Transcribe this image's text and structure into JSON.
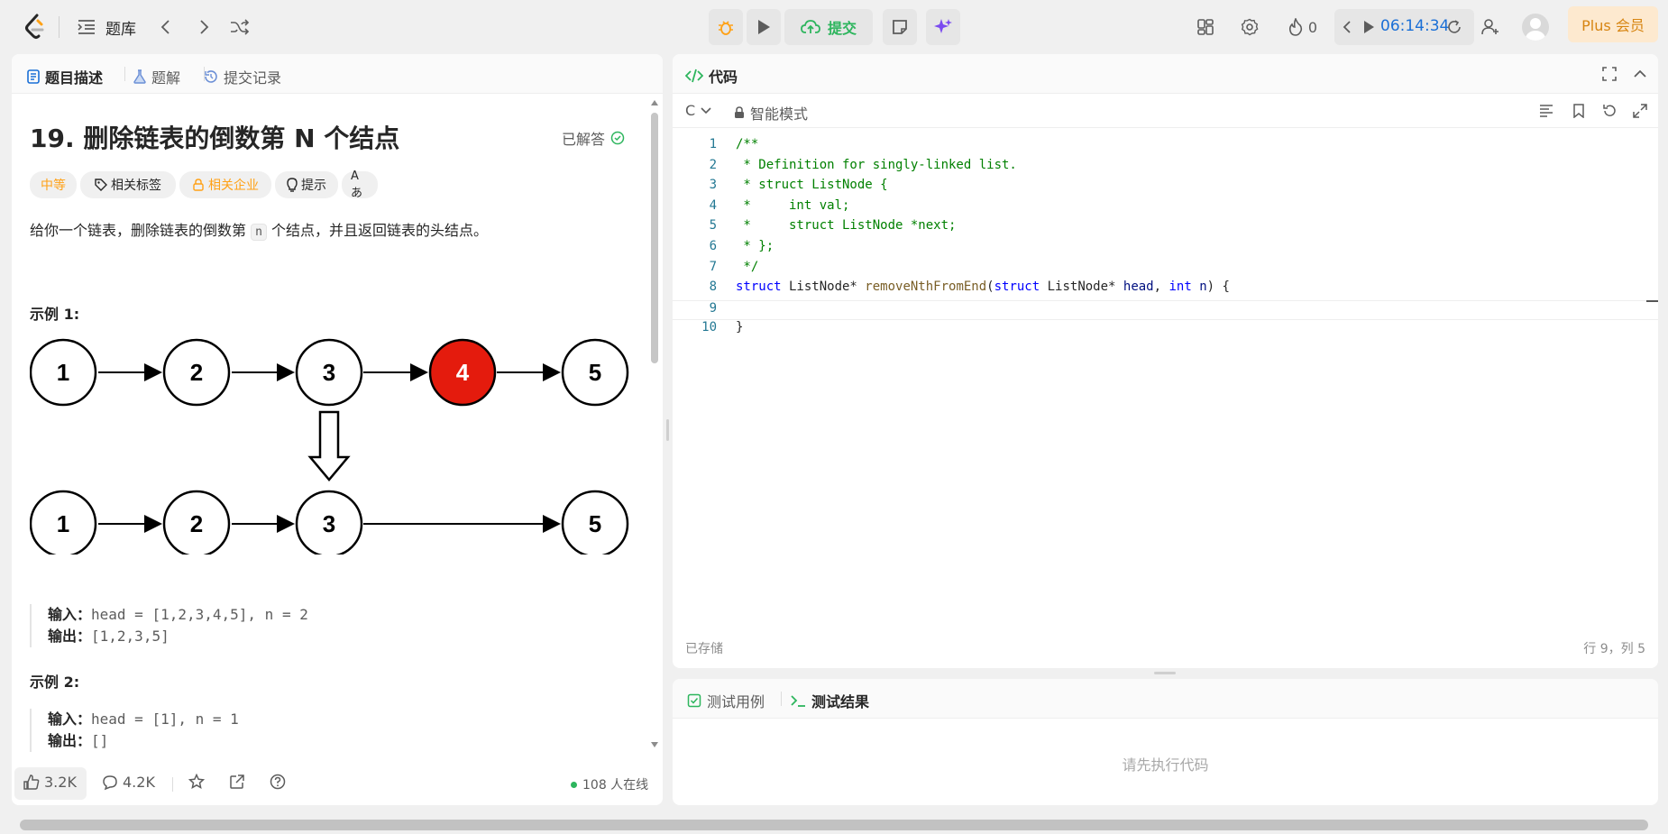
{
  "topbar": {
    "problem_list": "题库",
    "submit": "提交",
    "streak_count": "0",
    "timer": "06:14:34",
    "plus": "Plus 会员"
  },
  "left": {
    "tabs": [
      "题目描述",
      "题解",
      "提交记录"
    ],
    "title": "19. 删除链表的倒数第 N 个结点",
    "solved": "已解答",
    "chips": [
      "中等",
      "相关标签",
      "相关企业",
      "提示",
      "Aあ"
    ],
    "desc_before": "给你一个链表，删除链表的倒数第 ",
    "desc_code": "n",
    "desc_after": " 个结点，并且返回链表的头结点。",
    "example1_title": "示例 1:",
    "example1_input_label": "输入：",
    "example1_input": "head = [1,2,3,4,5], n = 2",
    "example1_output_label": "输出：",
    "example1_output": "[1,2,3,5]",
    "example2_title": "示例 2:",
    "example2_input_label": "输入：",
    "example2_input": "head = [1], n = 1",
    "example2_output_label": "输出：",
    "example2_output": "[]",
    "diagram_top": [
      "1",
      "2",
      "3",
      "4",
      "5"
    ],
    "diagram_bottom": [
      "1",
      "2",
      "3",
      "5"
    ],
    "likes": "3.2K",
    "comments": "4.2K",
    "online": "108 人在线"
  },
  "editor": {
    "title": "代码",
    "language": "C",
    "mode": "智能模式",
    "lines": [
      {
        "n": "1",
        "html": "<span class='cm'>/**</span>"
      },
      {
        "n": "2",
        "html": "<span class='cm'> * Definition for singly-linked list.</span>"
      },
      {
        "n": "3",
        "html": "<span class='cm'> * struct ListNode {</span>"
      },
      {
        "n": "4",
        "html": "<span class='cm'> *     int val;</span>"
      },
      {
        "n": "5",
        "html": "<span class='cm'> *     struct ListNode *next;</span>"
      },
      {
        "n": "6",
        "html": "<span class='cm'> * };</span>"
      },
      {
        "n": "7",
        "html": "<span class='cm'> */</span>"
      },
      {
        "n": "8",
        "html": "<span class='kw'>struct</span> ListNode* <span class='fn'>removeNthFromEnd</span>(<span class='kw'>struct</span> ListNode* <span class='pa'>head</span>, <span class='kw'>int</span> <span class='pa'>n</span>) {"
      },
      {
        "n": "9",
        "html": ""
      },
      {
        "n": "10",
        "html": "}"
      }
    ],
    "saved": "已存储",
    "cursor": "行 9，列 5"
  },
  "results": {
    "tabs": [
      "测试用例",
      "测试结果"
    ],
    "message": "请先执行代码"
  },
  "colors": {
    "accent_orange": "#ffa116",
    "submit_green": "#2db55d",
    "timer_blue": "#1a6fd6",
    "node_red": "#e41b0d"
  }
}
